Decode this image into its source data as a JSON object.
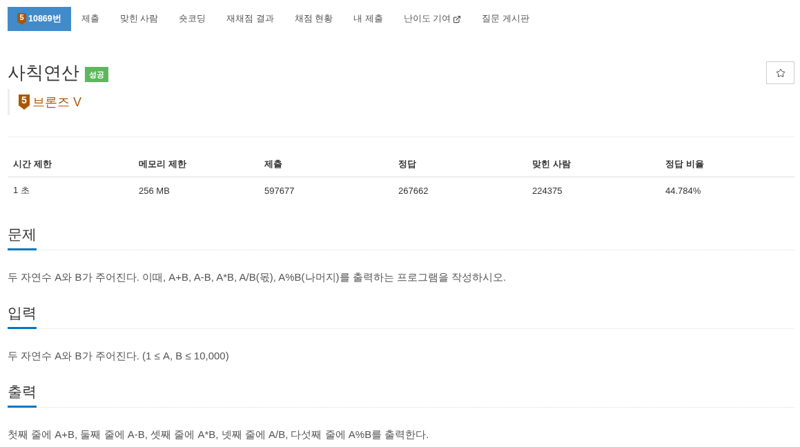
{
  "nav_tabs": [
    {
      "label": "10869번",
      "selected": true,
      "tier_digit": "5"
    },
    {
      "label": "제출",
      "selected": false
    },
    {
      "label": "맞힌 사람",
      "selected": false
    },
    {
      "label": "숏코딩",
      "selected": false
    },
    {
      "label": "재채점 결과",
      "selected": false
    },
    {
      "label": "채점 현황",
      "selected": false
    },
    {
      "label": "내 제출",
      "selected": false
    },
    {
      "label": "난이도 기여",
      "selected": false,
      "external": true
    },
    {
      "label": "질문 게시판",
      "selected": false
    }
  ],
  "problem": {
    "title": "사칙연산",
    "status": {
      "label": "성공",
      "kind": "success"
    },
    "starred": false,
    "tier": {
      "kind": "bronze",
      "digit": "5",
      "name": "브론즈 V"
    }
  },
  "limits_table": {
    "columns": [
      "시간 제한",
      "메모리 제한",
      "제출",
      "정답",
      "맞힌 사람",
      "정답 비율"
    ],
    "rows": [
      [
        "1 초",
        "256 MB",
        "597677",
        "267662",
        "224375",
        "44.784%"
      ]
    ]
  },
  "sections": [
    {
      "heading": "문제",
      "text": "두 자연수 A와 B가 주어진다. 이때, A+B, A-B, A*B, A/B(몫), A%B(나머지)를 출력하는 프로그램을 작성하시오."
    },
    {
      "heading": "입력",
      "text": "두 자연수 A와 B가 주어진다. (1 ≤ A, B ≤ 10,000)"
    },
    {
      "heading": "출력",
      "text": "첫째 줄에 A+B, 둘째 줄에 A-B, 셋째 줄에 A*B, 넷째 줄에 A/B, 다섯째 줄에 A%B를 출력한다."
    }
  ]
}
